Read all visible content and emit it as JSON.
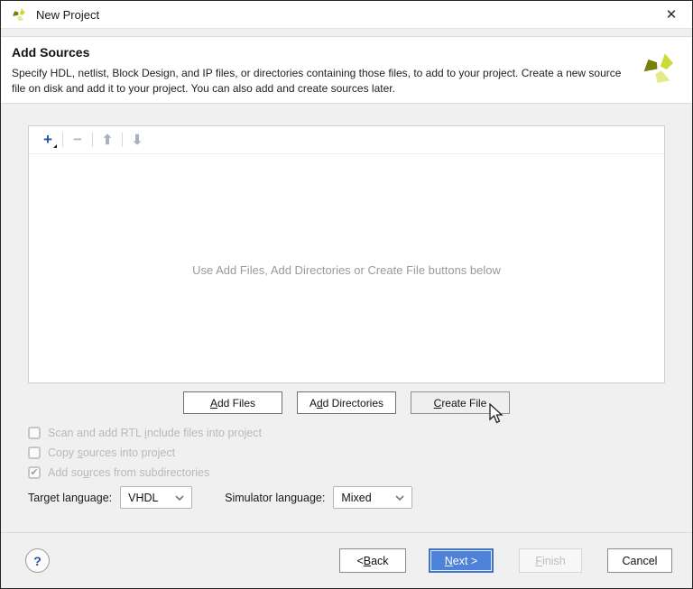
{
  "colors": {
    "accent_blue": "#4e81d8",
    "logo_bright": "#cdd936",
    "logo_light": "#e4ea8c",
    "logo_dark": "#76800a"
  },
  "window": {
    "title": "New Project",
    "close_glyph": "✕"
  },
  "header": {
    "title": "Add Sources",
    "description": "Specify HDL, netlist, Block Design, and IP files, or directories containing those files, to add to your project. Create a new source file on disk and add it to your project. You can also add and create sources later."
  },
  "toolbar": {
    "plus_glyph": "+",
    "minus_glyph": "−",
    "up_glyph": "⬆",
    "down_glyph": "⬇"
  },
  "sources_panel": {
    "empty_text": "Use Add Files, Add Directories or Create File buttons below"
  },
  "action_buttons": {
    "add_files": {
      "pre": "",
      "key": "A",
      "post": "dd Files"
    },
    "add_directories": {
      "pre": "A",
      "key": "d",
      "post": "d Directories"
    },
    "create_file": {
      "pre": "",
      "key": "C",
      "post": "reate File"
    }
  },
  "checkboxes": {
    "check_glyph": "✔",
    "items": [
      {
        "pre": "Scan and add RTL ",
        "key": "i",
        "post": "nclude files into project",
        "checked": false
      },
      {
        "pre": "Copy ",
        "key": "s",
        "post": "ources into project",
        "checked": false
      },
      {
        "pre": "Add so",
        "key": "u",
        "post": "rces from subdirectories",
        "checked": true
      }
    ]
  },
  "language": {
    "target_label": "Target language:",
    "target_value": "VHDL",
    "simulator_label": "Simulator language:",
    "simulator_value": "Mixed"
  },
  "footer": {
    "help_glyph": "?",
    "back": {
      "pre": "< ",
      "key": "B",
      "post": "ack"
    },
    "next": {
      "pre": "",
      "key": "N",
      "post": "ext >"
    },
    "finish": {
      "pre": "",
      "key": "F",
      "post": "inish"
    },
    "cancel": {
      "label": "Cancel"
    }
  }
}
